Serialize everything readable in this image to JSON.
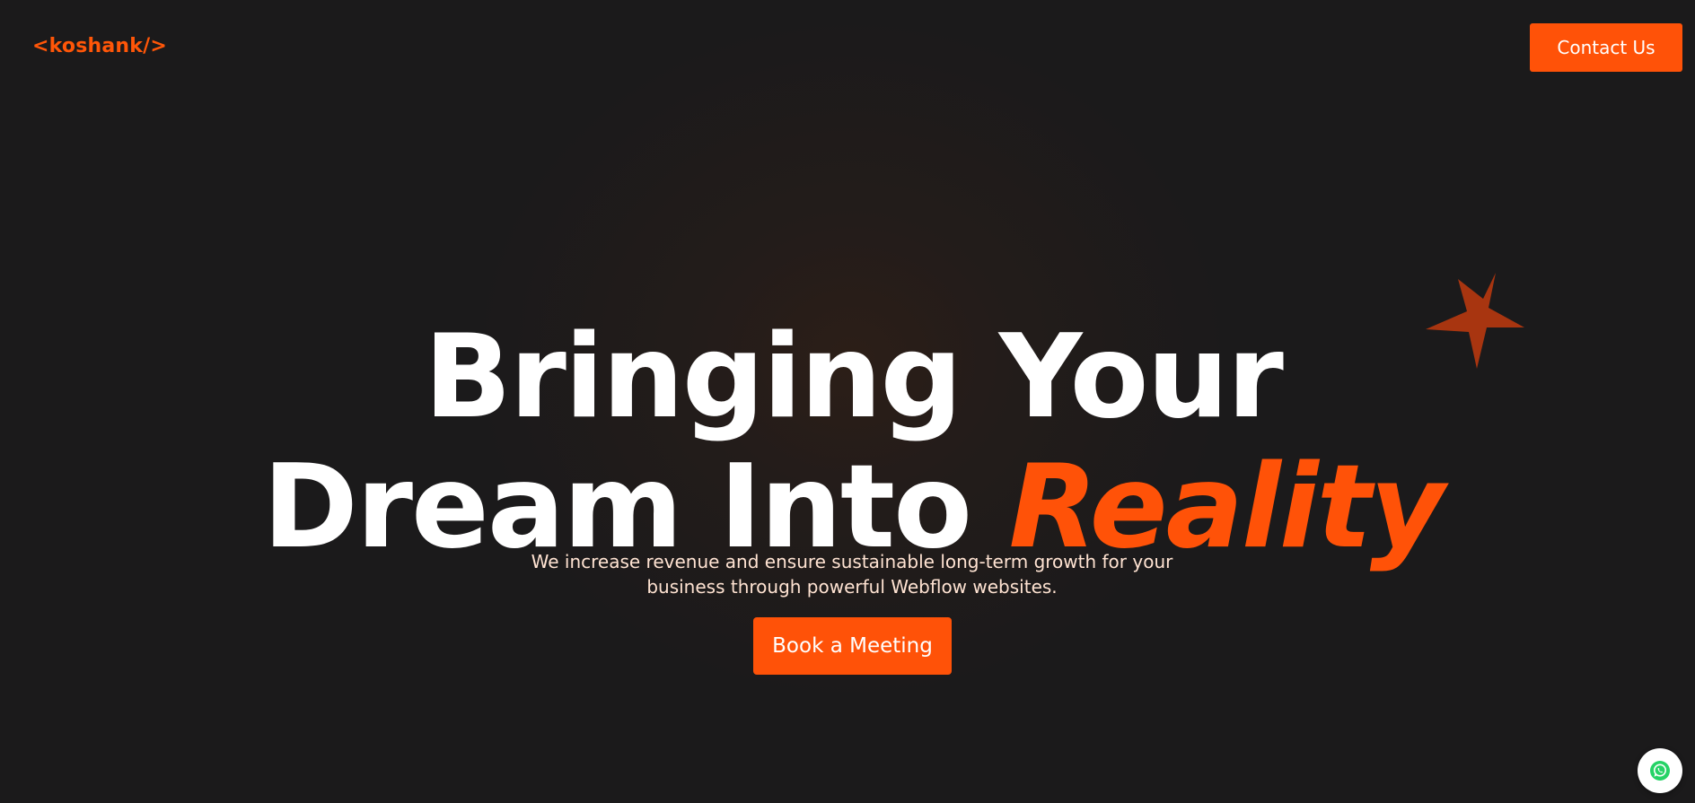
{
  "header": {
    "logo_text": "<koshank/>",
    "contact_label": "Contact Us"
  },
  "hero": {
    "headline_line1": "Bringing Your",
    "headline_line2_plain": "Dream Into",
    "headline_line2_accent": "Reality",
    "subtitle": "We increase revenue and ensure sustainable long-term growth for your business through powerful Webflow websites.",
    "cta_label": "Book a Meeting"
  },
  "decor": {
    "star_icon": "star-icon",
    "whatsapp_icon": "whatsapp-icon"
  },
  "colors": {
    "background": "#1b1a1b",
    "accent": "#ff5208",
    "star": "#a83510",
    "headline": "#ffffff",
    "subtitle": "#ffe3d2"
  }
}
